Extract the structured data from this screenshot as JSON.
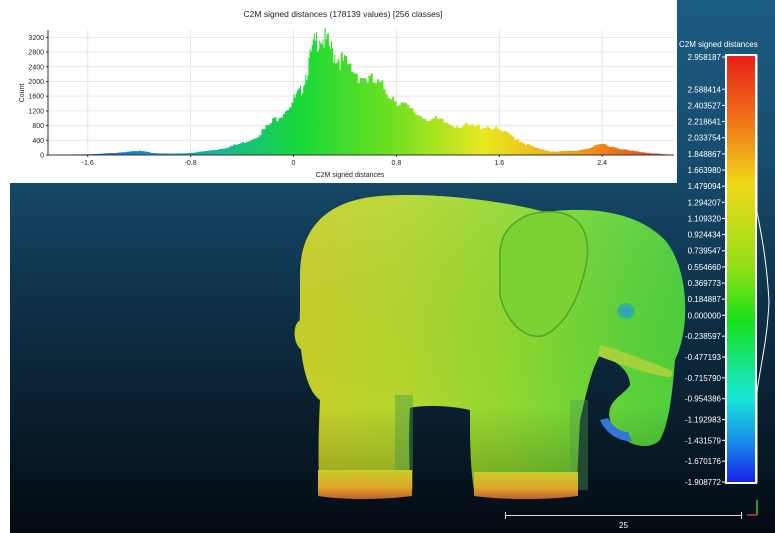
{
  "histogram": {
    "title": "C2M signed distances (178139 values)  [256 classes]",
    "ylabel": "Count",
    "xlabel": "C2M signed distances",
    "y_ticks": [
      "0",
      "400",
      "800",
      "1200",
      "1600",
      "2000",
      "2400",
      "2800",
      "3200"
    ],
    "x_ticks": [
      "-1.6",
      "-0.8",
      "0",
      "0.8",
      "1.6",
      "2.4"
    ]
  },
  "chart_data": {
    "type": "bar",
    "title": "C2M signed distances (178139 values)  [256 classes]",
    "xlabel": "C2M signed distances",
    "ylabel": "Count",
    "xlim": [
      -1.908772,
      2.958187
    ],
    "ylim": [
      0,
      3400
    ],
    "classes": 256,
    "total_values": 178139,
    "x": [
      -1.85,
      -1.6,
      -1.4,
      -1.2,
      -1.1,
      -1.0,
      -0.9,
      -0.8,
      -0.7,
      -0.6,
      -0.5,
      -0.4,
      -0.3,
      -0.2,
      -0.1,
      0.0,
      0.05,
      0.1,
      0.15,
      0.2,
      0.25,
      0.3,
      0.35,
      0.4,
      0.5,
      0.6,
      0.7,
      0.8,
      0.9,
      1.0,
      1.1,
      1.2,
      1.3,
      1.4,
      1.5,
      1.6,
      1.7,
      1.8,
      1.9,
      2.0,
      2.1,
      2.2,
      2.3,
      2.4,
      2.5,
      2.6,
      2.7,
      2.8,
      2.9
    ],
    "values": [
      10,
      20,
      60,
      110,
      60,
      40,
      40,
      60,
      100,
      150,
      230,
      330,
      500,
      800,
      1150,
      1500,
      1700,
      2300,
      2900,
      3300,
      3050,
      2800,
      2650,
      2450,
      2200,
      2000,
      1800,
      1500,
      1200,
      1050,
      950,
      850,
      800,
      760,
      800,
      650,
      500,
      300,
      160,
      100,
      100,
      120,
      200,
      300,
      200,
      120,
      80,
      40,
      15
    ],
    "grid": true
  },
  "scale": {
    "title": "C2M signed distances",
    "values": [
      "2.958187",
      "2.588414",
      "2.403527",
      "2.218641",
      "2.033754",
      "1.848867",
      "1.663980",
      "1.479094",
      "1.294207",
      "1.109320",
      "0.924434",
      "0.739547",
      "0.554660",
      "0.369773",
      "0.184887",
      "0.000000",
      "-0.238597",
      "-0.477193",
      "-0.715790",
      "-0.954386",
      "-1.192983",
      "-1.431579",
      "-1.670176",
      "-1.908772"
    ]
  },
  "bottom_scale": {
    "label": "25"
  },
  "colors": {
    "background_top": "#1c5c82",
    "background_bottom": "#040b12",
    "elephant_main": "#6fd33a",
    "elephant_warm": "#e0c21a",
    "elephant_hot": "#d0601f"
  }
}
